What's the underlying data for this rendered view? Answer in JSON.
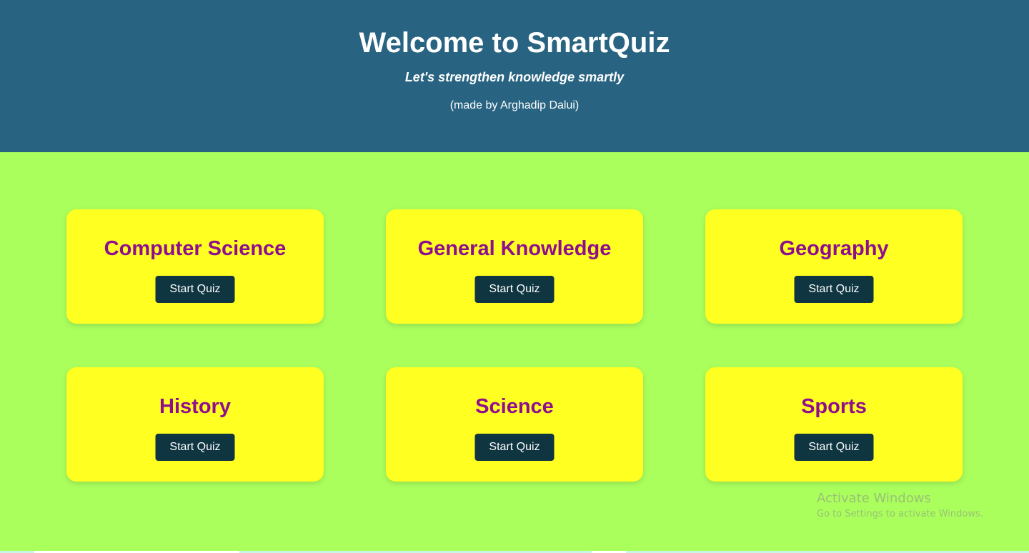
{
  "header": {
    "title": "Welcome to SmartQuiz",
    "tagline": "Let's strengthen knowledge smartly",
    "credit": "(made by Arghadip Dalui)"
  },
  "categories": [
    {
      "title": "Computer Science",
      "button_label": "Start Quiz"
    },
    {
      "title": "General Knowledge",
      "button_label": "Start Quiz"
    },
    {
      "title": "Geography",
      "button_label": "Start Quiz"
    },
    {
      "title": "History",
      "button_label": "Start Quiz"
    },
    {
      "title": "Science",
      "button_label": "Start Quiz"
    },
    {
      "title": "Sports",
      "button_label": "Start Quiz"
    }
  ],
  "watermark": {
    "title": "Activate Windows",
    "subtitle": "Go to Settings to activate Windows."
  },
  "colors": {
    "header_bg": "#286381",
    "page_bg": "#aaff5c",
    "card_bg": "#ffff22",
    "card_title": "#8e0e8e",
    "button_bg": "#0e3540"
  }
}
